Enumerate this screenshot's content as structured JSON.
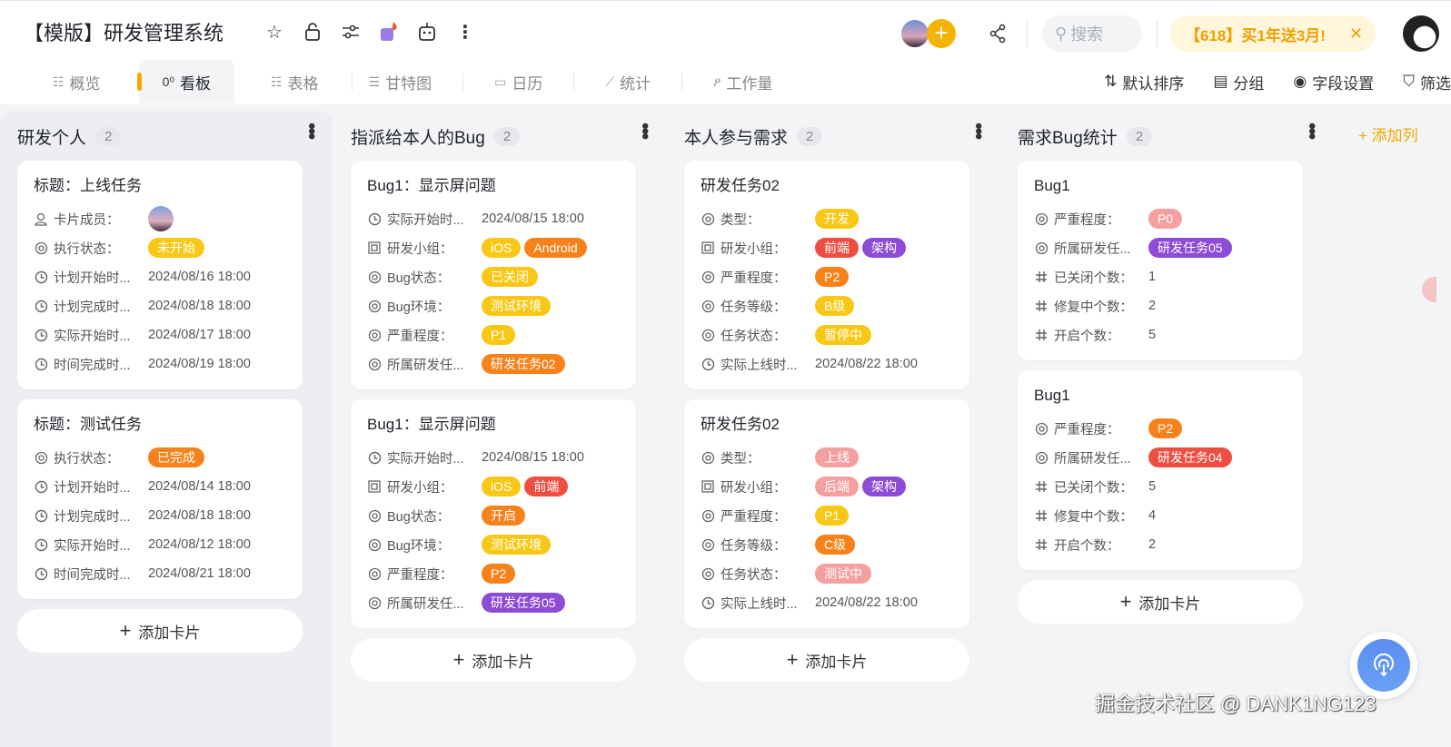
{
  "header": {
    "title": "【模版】研发管理系统",
    "search_placeholder": "搜索",
    "promo": "【618】买1年送3月!",
    "promo_close": "✕"
  },
  "tabs": [
    {
      "label": "概览",
      "icon": "☷"
    },
    {
      "label": "看板",
      "icon": "0⁰"
    },
    {
      "label": "表格",
      "icon": "☷"
    },
    {
      "label": "甘特图",
      "icon": "☰"
    },
    {
      "label": "日历",
      "icon": "▭"
    },
    {
      "label": "统计",
      "icon": "⟋"
    },
    {
      "label": "工作量",
      "icon": "ዖ"
    }
  ],
  "toolbar": {
    "sort": "默认排序",
    "group": "分组",
    "fields": "字段设置",
    "filter": "筛选"
  },
  "add_column": "+ 添加列",
  "add_card": "添加卡片",
  "watermark": "掘金技术社区 @ DANK1NG123",
  "colors": {
    "yellow": "#f9c817",
    "orange": "#f7821b",
    "red": "#f04d41",
    "purple": "#8e4bd6",
    "pink": "#f4a0a0"
  },
  "columns": [
    {
      "title": "研发个人",
      "count": "2",
      "cards": [
        {
          "title": "标题：上线任务",
          "rows": [
            {
              "icon": "person",
              "label": "卡片成员：",
              "avatar": true
            },
            {
              "icon": "target",
              "label": "执行状态：",
              "tags": [
                {
                  "t": "未开始",
                  "c": "yellow"
                }
              ]
            },
            {
              "icon": "clock",
              "label": "计划开始时...",
              "value": "2024/08/16 18:00"
            },
            {
              "icon": "clock",
              "label": "计划完成时...",
              "value": "2024/08/18 18:00"
            },
            {
              "icon": "clock",
              "label": "实际开始时...",
              "value": "2024/08/17 18:00"
            },
            {
              "icon": "clock",
              "label": "时间完成时...",
              "value": "2024/08/19 18:00"
            }
          ]
        },
        {
          "title": "标题：测试任务",
          "rows": [
            {
              "icon": "target",
              "label": "执行状态：",
              "tags": [
                {
                  "t": "已完成",
                  "c": "orange"
                }
              ]
            },
            {
              "icon": "clock",
              "label": "计划开始时...",
              "value": "2024/08/14 18:00"
            },
            {
              "icon": "clock",
              "label": "计划完成时...",
              "value": "2024/08/18 18:00"
            },
            {
              "icon": "clock",
              "label": "实际开始时...",
              "value": "2024/08/12 18:00"
            },
            {
              "icon": "clock",
              "label": "时间完成时...",
              "value": "2024/08/21 18:00"
            }
          ]
        }
      ]
    },
    {
      "title": "指派给本人的Bug",
      "count": "2",
      "cards": [
        {
          "title": "Bug1：显示屏问题",
          "rows": [
            {
              "icon": "clock",
              "label": "实际开始时...",
              "value": "2024/08/15 18:00"
            },
            {
              "icon": "group",
              "label": "研发小组：",
              "tags": [
                {
                  "t": "iOS",
                  "c": "yellow"
                },
                {
                  "t": "Android",
                  "c": "orange"
                }
              ]
            },
            {
              "icon": "target",
              "label": "Bug状态：",
              "tags": [
                {
                  "t": "已关闭",
                  "c": "yellow"
                }
              ]
            },
            {
              "icon": "target",
              "label": "Bug环境：",
              "tags": [
                {
                  "t": "测试环境",
                  "c": "yellow"
                }
              ]
            },
            {
              "icon": "target",
              "label": "严重程度：",
              "tags": [
                {
                  "t": "P1",
                  "c": "yellow"
                }
              ]
            },
            {
              "icon": "target",
              "label": "所属研发任...",
              "tags": [
                {
                  "t": "研发任务02",
                  "c": "orange"
                }
              ]
            }
          ]
        },
        {
          "title": "Bug1：显示屏问题",
          "rows": [
            {
              "icon": "clock",
              "label": "实际开始时...",
              "value": "2024/08/15 18:00"
            },
            {
              "icon": "group",
              "label": "研发小组：",
              "tags": [
                {
                  "t": "iOS",
                  "c": "yellow"
                },
                {
                  "t": "前端",
                  "c": "red"
                }
              ]
            },
            {
              "icon": "target",
              "label": "Bug状态：",
              "tags": [
                {
                  "t": "开启",
                  "c": "orange"
                }
              ]
            },
            {
              "icon": "target",
              "label": "Bug环境：",
              "tags": [
                {
                  "t": "测试环境",
                  "c": "yellow"
                }
              ]
            },
            {
              "icon": "target",
              "label": "严重程度：",
              "tags": [
                {
                  "t": "P2",
                  "c": "orange"
                }
              ]
            },
            {
              "icon": "target",
              "label": "所属研发任...",
              "tags": [
                {
                  "t": "研发任务05",
                  "c": "purple"
                }
              ]
            }
          ]
        }
      ]
    },
    {
      "title": "本人参与需求",
      "count": "2",
      "cards": [
        {
          "title": "研发任务02",
          "rows": [
            {
              "icon": "target",
              "label": "类型：",
              "tags": [
                {
                  "t": "开发",
                  "c": "yellow"
                }
              ]
            },
            {
              "icon": "group",
              "label": "研发小组：",
              "tags": [
                {
                  "t": "前端",
                  "c": "red"
                },
                {
                  "t": "架构",
                  "c": "purple"
                }
              ]
            },
            {
              "icon": "target",
              "label": "严重程度：",
              "tags": [
                {
                  "t": "P2",
                  "c": "orange"
                }
              ]
            },
            {
              "icon": "target",
              "label": "任务等级：",
              "tags": [
                {
                  "t": "B级",
                  "c": "yellow"
                }
              ]
            },
            {
              "icon": "target",
              "label": "任务状态：",
              "tags": [
                {
                  "t": "暂停中",
                  "c": "yellow"
                }
              ]
            },
            {
              "icon": "clock",
              "label": "实际上线时...",
              "value": "2024/08/22 18:00"
            }
          ]
        },
        {
          "title": "研发任务02",
          "rows": [
            {
              "icon": "target",
              "label": "类型：",
              "tags": [
                {
                  "t": "上线",
                  "c": "pink"
                }
              ]
            },
            {
              "icon": "group",
              "label": "研发小组：",
              "tags": [
                {
                  "t": "后端",
                  "c": "pink"
                },
                {
                  "t": "架构",
                  "c": "purple"
                }
              ]
            },
            {
              "icon": "target",
              "label": "严重程度：",
              "tags": [
                {
                  "t": "P1",
                  "c": "yellow"
                }
              ]
            },
            {
              "icon": "target",
              "label": "任务等级：",
              "tags": [
                {
                  "t": "C级",
                  "c": "orange"
                }
              ]
            },
            {
              "icon": "target",
              "label": "任务状态：",
              "tags": [
                {
                  "t": "测试中",
                  "c": "pink"
                }
              ]
            },
            {
              "icon": "clock",
              "label": "实际上线时...",
              "value": "2024/08/22 18:00"
            }
          ]
        }
      ]
    },
    {
      "title": "需求Bug统计",
      "count": "2",
      "cards": [
        {
          "title": "Bug1",
          "rows": [
            {
              "icon": "target",
              "label": "严重程度：",
              "tags": [
                {
                  "t": "P0",
                  "c": "pink"
                }
              ]
            },
            {
              "icon": "target",
              "label": "所属研发任...",
              "tags": [
                {
                  "t": "研发任务05",
                  "c": "purple"
                }
              ]
            },
            {
              "icon": "hash",
              "label": "已关闭个数：",
              "value": "1"
            },
            {
              "icon": "hash",
              "label": "修复中个数：",
              "value": "2"
            },
            {
              "icon": "hash",
              "label": "开启个数：",
              "value": "5"
            }
          ]
        },
        {
          "title": "Bug1",
          "rows": [
            {
              "icon": "target",
              "label": "严重程度：",
              "tags": [
                {
                  "t": "P2",
                  "c": "orange"
                }
              ]
            },
            {
              "icon": "target",
              "label": "所属研发任...",
              "tags": [
                {
                  "t": "研发任务04",
                  "c": "red"
                }
              ]
            },
            {
              "icon": "hash",
              "label": "已关闭个数：",
              "value": "5"
            },
            {
              "icon": "hash",
              "label": "修复中个数：",
              "value": "4"
            },
            {
              "icon": "hash",
              "label": "开启个数：",
              "value": "2"
            }
          ]
        }
      ]
    }
  ]
}
